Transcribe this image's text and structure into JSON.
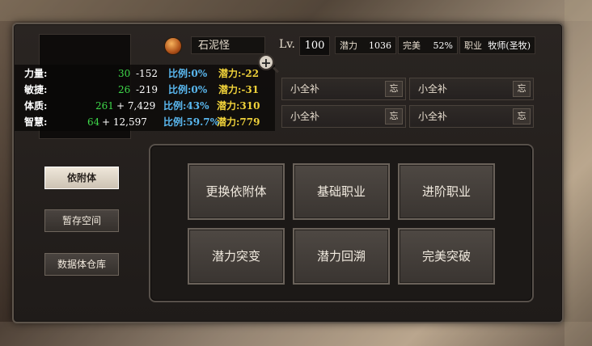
{
  "character": {
    "name": "石泥怪",
    "level_label": "Lv.",
    "level": "100"
  },
  "info": [
    {
      "key": "潜力",
      "value": "1036"
    },
    {
      "key": "完美",
      "value": "52%"
    },
    {
      "key": "职业",
      "value": "牧师(圣牧)"
    }
  ],
  "stats": [
    {
      "label": "力量:",
      "base": "30",
      "bonus": "-152",
      "ratio": "比例:0%",
      "potential": "潜力:-22"
    },
    {
      "label": "敏捷:",
      "base": "26",
      "bonus": "-219",
      "ratio": "比例:0%",
      "potential": "潜力:-31"
    },
    {
      "label": "体质:",
      "base": "261",
      "bonus": "+ 7,429",
      "ratio": "比例:43%",
      "potential": "潜力:310"
    },
    {
      "label": "智慧:",
      "base": "64",
      "bonus": "+ 12,597",
      "ratio": "比例:59.7%",
      "potential": "潜力:779"
    }
  ],
  "slots": [
    {
      "label": "小全补",
      "button": "忘"
    },
    {
      "label": "小全补",
      "button": "忘"
    },
    {
      "label": "小全补",
      "button": "忘"
    },
    {
      "label": "小全补",
      "button": "忘"
    }
  ],
  "side_menu": [
    {
      "label": "依附体",
      "active": true
    },
    {
      "label": "暂存空间",
      "active": false
    },
    {
      "label": "数据体仓库",
      "active": false
    }
  ],
  "actions": [
    "更换依附体",
    "基础职业",
    "进阶职业",
    "潜力突变",
    "潜力回溯",
    "完美突破"
  ],
  "zoom_symbol": "+",
  "colors": {
    "base_value": "#3ed94a",
    "ratio": "#5ab8f0",
    "potential": "#f0d23a",
    "panel_bg": "#1f1b19"
  }
}
